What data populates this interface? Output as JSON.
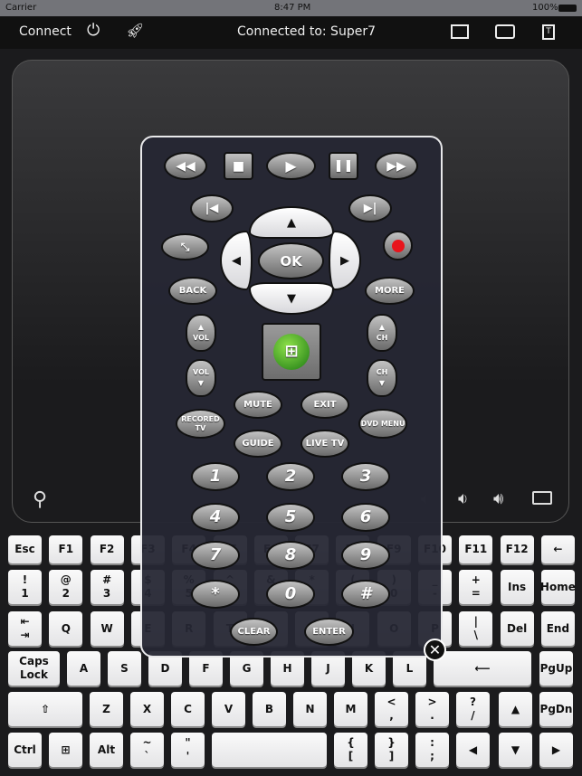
{
  "status_bar": {
    "carrier": "Carrier",
    "time": "8:47 PM",
    "battery": "100%"
  },
  "nav": {
    "connect": "Connect",
    "connected": "Connected to: Super7",
    "icons": [
      "power-icon",
      "rocket-icon",
      "film-icon",
      "switch-icon",
      "text-file-icon"
    ]
  },
  "keyboard": {
    "rows": [
      [
        [
          "Esc"
        ],
        [
          "F1"
        ],
        [
          "F2"
        ],
        [
          "F3"
        ],
        [
          "F4"
        ],
        [
          "F5"
        ],
        [
          "F6"
        ],
        [
          "F7"
        ],
        [
          "F8"
        ],
        [
          "F9"
        ],
        [
          "F10"
        ],
        [
          "F11"
        ],
        [
          "F12"
        ],
        [
          "←"
        ]
      ],
      [
        [
          "!",
          "1"
        ],
        [
          "@",
          "2"
        ],
        [
          "#",
          "3"
        ],
        [
          "$",
          "4"
        ],
        [
          "%",
          "5"
        ],
        [
          "^",
          "6"
        ],
        [
          "&",
          "7"
        ],
        [
          "*",
          "8"
        ],
        [
          "(",
          "9"
        ],
        [
          ")",
          "0"
        ],
        [
          "_",
          "-"
        ],
        [
          "+",
          "="
        ],
        [
          "Ins"
        ],
        [
          "Home"
        ]
      ],
      [
        [
          "⇤",
          "⇥"
        ],
        [
          "Q"
        ],
        [
          "W"
        ],
        [
          "E"
        ],
        [
          "R"
        ],
        [
          "T"
        ],
        [
          "Y"
        ],
        [
          "U"
        ],
        [
          "I"
        ],
        [
          "O"
        ],
        [
          "P"
        ],
        [
          "|",
          "\\"
        ],
        [
          "Del"
        ],
        [
          "End"
        ]
      ],
      [
        [
          "Caps",
          "Lock"
        ],
        [
          "A"
        ],
        [
          "S"
        ],
        [
          "D"
        ],
        [
          "F"
        ],
        [
          "G"
        ],
        [
          "H"
        ],
        [
          "J"
        ],
        [
          "K"
        ],
        [
          "L"
        ],
        [
          "⟵"
        ],
        [
          "PgUp"
        ]
      ],
      [
        [
          "⇧"
        ],
        [
          "Z"
        ],
        [
          "X"
        ],
        [
          "C"
        ],
        [
          "V"
        ],
        [
          "B"
        ],
        [
          "N"
        ],
        [
          "M"
        ],
        [
          "<",
          ","
        ],
        [
          ">",
          "."
        ],
        [
          "?",
          "/"
        ],
        [
          "▲"
        ],
        [
          "PgDn"
        ]
      ],
      [
        [
          "Ctrl"
        ],
        [
          "⊞"
        ],
        [
          "Alt"
        ],
        [
          "~",
          "`"
        ],
        [
          "\"",
          "'"
        ],
        [
          ""
        ],
        [
          "{",
          "["
        ],
        [
          "}",
          "]"
        ],
        [
          ":",
          ";"
        ],
        [
          "◀"
        ],
        [
          "▼"
        ],
        [
          "▶"
        ]
      ]
    ]
  },
  "remote": {
    "ok": "OK",
    "back": "BACK",
    "more": "MORE",
    "vol": "VOL",
    "ch": "CH",
    "mute": "MUTE",
    "exit": "EXIT",
    "recorded_tv": "RECORED TV",
    "dvd_menu": "DVD MENU",
    "guide": "GUIDE",
    "live_tv": "LIVE TV",
    "numbers": [
      "1",
      "2",
      "3",
      "4",
      "5",
      "6",
      "7",
      "8",
      "9",
      "*",
      "0",
      "#"
    ],
    "clear": "CLEAR",
    "enter": "ENTER",
    "record_color": "#e8141c"
  }
}
